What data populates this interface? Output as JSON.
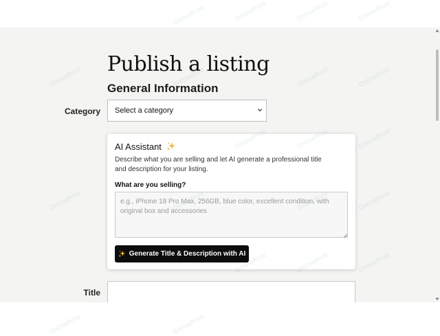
{
  "page": {
    "title": "Publish a listing",
    "section_title": "General Information"
  },
  "category": {
    "label": "Category",
    "selected": "Select a category"
  },
  "ai_assistant": {
    "title": "AI Assistant",
    "title_icon": "sparkles-icon",
    "description": "Describe what you are selling and let AI generate a professional title and description for your listing.",
    "question_label": "What are you selling?",
    "placeholder": "e.g., iPhone 18 Pro Max, 256GB, blue color, excellent condition, with original box and accessories",
    "button_label": "Generate Title & Description with AI",
    "button_icon": "sparkles-icon"
  },
  "title_field": {
    "label": "Title"
  },
  "watermark": {
    "text": "OnlinePrint"
  },
  "colors": {
    "background": "#f4f4f2",
    "button": "#0d0d0d",
    "sparkle": "#f2b233"
  }
}
